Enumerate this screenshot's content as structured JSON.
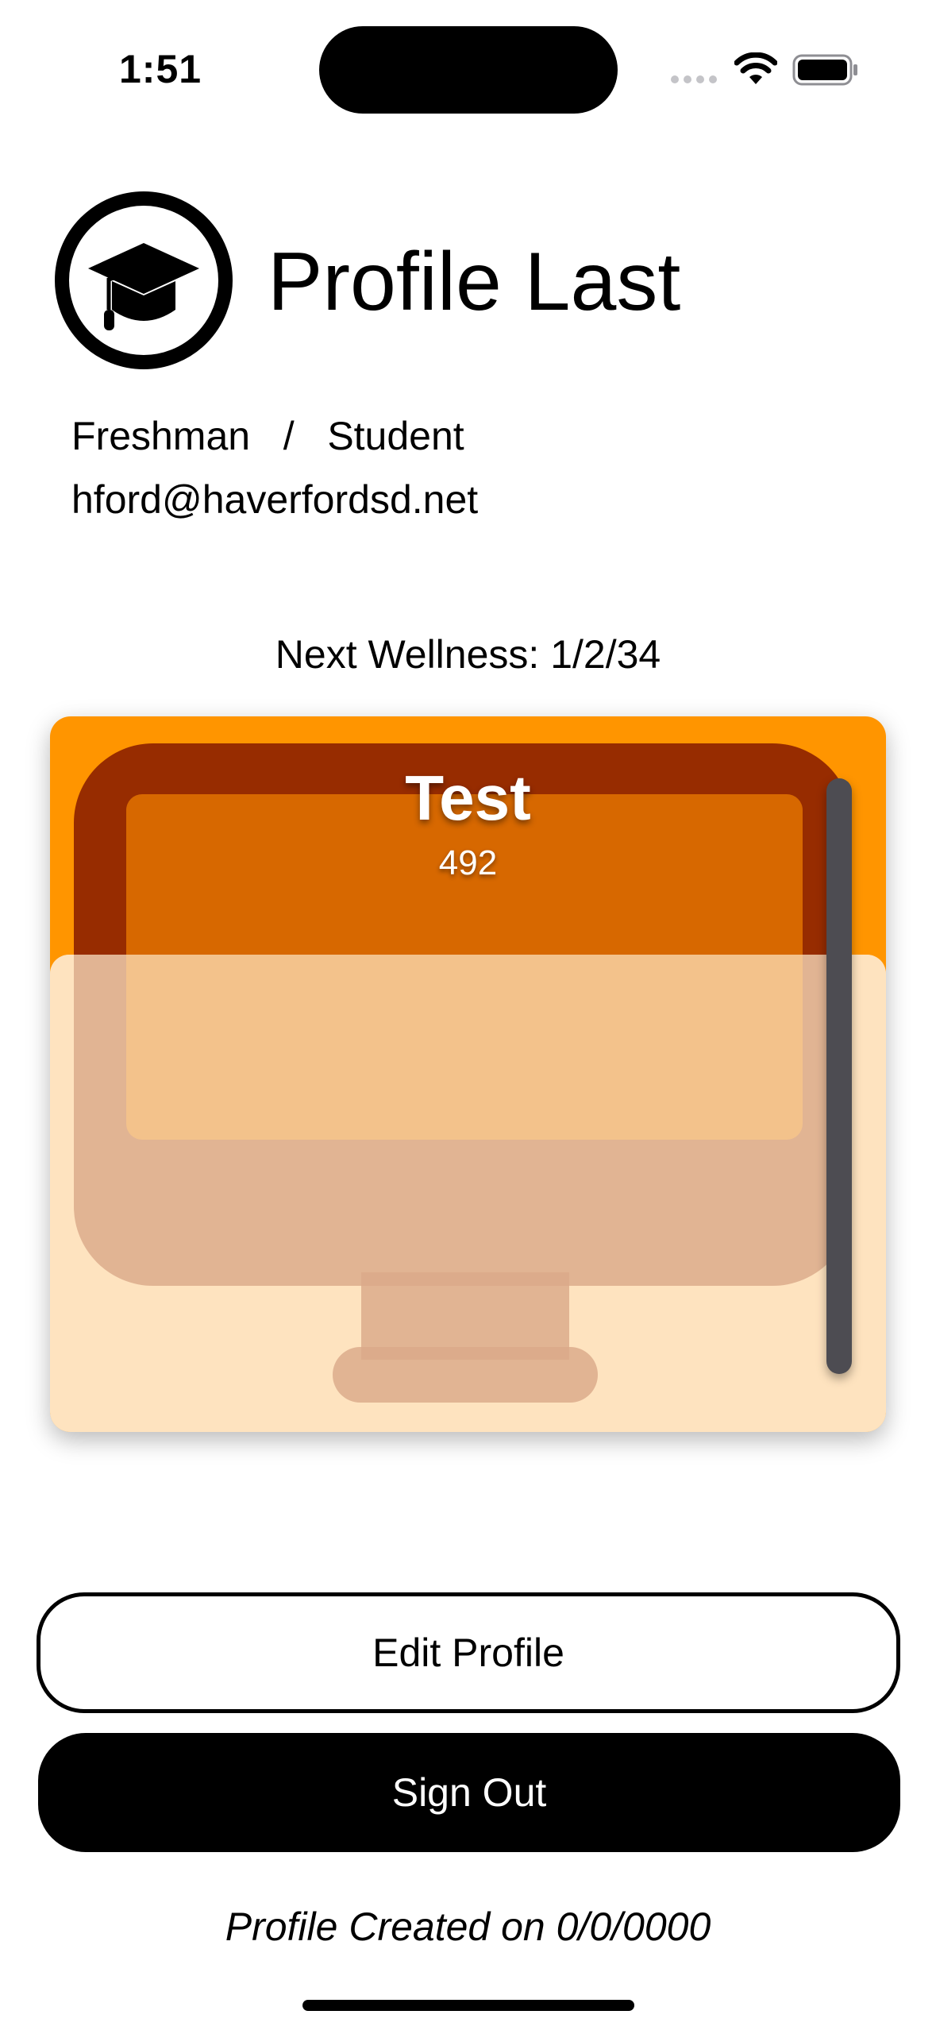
{
  "status_bar": {
    "time": "1:51",
    "wifi_icon": "wifi-icon",
    "battery_icon": "battery-icon"
  },
  "profile": {
    "avatar_icon": "graduation-cap-icon",
    "name": "Profile Last",
    "grade_role": "Freshman   /   Student",
    "email": "hford@haverfordsd.net"
  },
  "wellness": {
    "next_label": "Next Wellness: 1/2/34"
  },
  "card": {
    "title": "Test",
    "value": "492",
    "icon": "desktop-computer-icon",
    "colors": {
      "background": "#ff9500",
      "lower": "#fde3bf",
      "icon": "#801500"
    }
  },
  "buttons": {
    "edit_label": "Edit Profile",
    "signout_label": "Sign Out"
  },
  "footer": {
    "created_on": "Profile Created on 0/0/0000"
  }
}
